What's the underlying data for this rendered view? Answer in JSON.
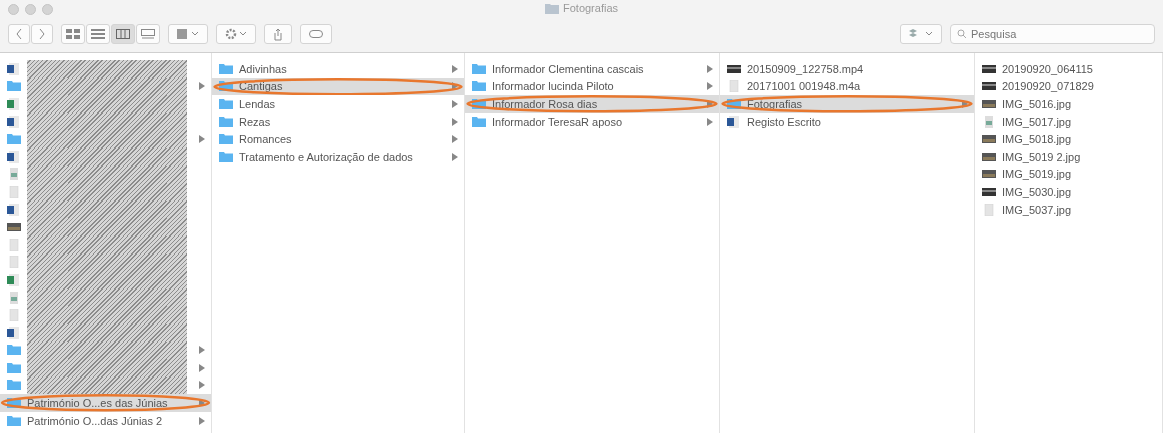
{
  "window": {
    "title": "Fotografias"
  },
  "toolbar": {
    "views": [
      {
        "kind": "icons",
        "selected": false
      },
      {
        "kind": "list",
        "selected": false
      },
      {
        "kind": "columns",
        "selected": true
      },
      {
        "kind": "gallery",
        "selected": false
      }
    ],
    "search": {
      "placeholder": "Pesquisa"
    }
  },
  "columns": [
    {
      "items": [
        {
          "kind": "word",
          "redacted": true,
          "arrow": false,
          "selected": false,
          "circled": false
        },
        {
          "kind": "folder",
          "redacted": true,
          "arrow": true,
          "selected": false,
          "circled": false
        },
        {
          "kind": "excel",
          "redacted": true,
          "arrow": false,
          "selected": false,
          "circled": false
        },
        {
          "kind": "word",
          "redacted": true,
          "arrow": false,
          "selected": false,
          "circled": false
        },
        {
          "kind": "folder",
          "redacted": true,
          "arrow": true,
          "selected": false,
          "circled": false
        },
        {
          "kind": "word",
          "redacted": true,
          "arrow": false,
          "selected": false,
          "circled": false
        },
        {
          "kind": "image",
          "redacted": true,
          "arrow": false,
          "selected": false,
          "circled": false
        },
        {
          "kind": "file",
          "redacted": true,
          "arrow": false,
          "selected": false,
          "circled": false
        },
        {
          "kind": "word",
          "redacted": true,
          "arrow": false,
          "selected": false,
          "circled": false
        },
        {
          "kind": "photo",
          "redacted": true,
          "arrow": false,
          "selected": false,
          "circled": false
        },
        {
          "kind": "file",
          "redacted": true,
          "arrow": false,
          "selected": false,
          "circled": false
        },
        {
          "kind": "file",
          "redacted": true,
          "arrow": false,
          "selected": false,
          "circled": false
        },
        {
          "kind": "excel",
          "redacted": true,
          "arrow": false,
          "selected": false,
          "circled": false
        },
        {
          "kind": "image",
          "redacted": true,
          "arrow": false,
          "selected": false,
          "circled": false
        },
        {
          "kind": "file",
          "redacted": true,
          "arrow": false,
          "selected": false,
          "circled": false
        },
        {
          "kind": "word",
          "redacted": true,
          "arrow": false,
          "selected": false,
          "circled": false
        },
        {
          "kind": "folder",
          "redacted": true,
          "arrow": true,
          "selected": false,
          "circled": false
        },
        {
          "kind": "folder",
          "redacted": true,
          "arrow": true,
          "selected": false,
          "circled": false
        },
        {
          "kind": "folder",
          "redacted": true,
          "arrow": true,
          "selected": false,
          "circled": false
        },
        {
          "name": "Património O...es das Júnias",
          "kind": "folder",
          "redacted": false,
          "arrow": true,
          "selected": true,
          "circled": true
        },
        {
          "name": "Património O...das Júnias 2",
          "kind": "folder",
          "redacted": false,
          "arrow": true,
          "selected": false,
          "circled": false
        }
      ]
    },
    {
      "items": [
        {
          "name": "Adivinhas",
          "kind": "folder",
          "arrow": true,
          "selected": false,
          "circled": false
        },
        {
          "name": "Cantigas",
          "kind": "folder",
          "arrow": true,
          "selected": true,
          "circled": true
        },
        {
          "name": "Lendas",
          "kind": "folder",
          "arrow": true,
          "selected": false,
          "circled": false
        },
        {
          "name": "Rezas",
          "kind": "folder",
          "arrow": true,
          "selected": false,
          "circled": false
        },
        {
          "name": "Romances",
          "kind": "folder",
          "arrow": true,
          "selected": false,
          "circled": false
        },
        {
          "name": "Tratamento e Autorização de dados",
          "kind": "folder",
          "arrow": true,
          "selected": false,
          "circled": false
        }
      ]
    },
    {
      "items": [
        {
          "name": "Informador Clementina cascais",
          "kind": "folder",
          "arrow": true,
          "selected": false,
          "circled": false
        },
        {
          "name": "Informador lucinda Piloto",
          "kind": "folder",
          "arrow": true,
          "selected": false,
          "circled": false
        },
        {
          "name": "Informador Rosa dias",
          "kind": "folder",
          "arrow": true,
          "selected": true,
          "circled": true
        },
        {
          "name": "Informador TeresaR aposo",
          "kind": "folder",
          "arrow": true,
          "selected": false,
          "circled": false
        }
      ]
    },
    {
      "items": [
        {
          "name": "20150909_122758.mp4",
          "kind": "video",
          "arrow": false,
          "selected": false,
          "circled": false
        },
        {
          "name": "20171001 001948.m4a",
          "kind": "file",
          "arrow": false,
          "selected": false,
          "circled": false
        },
        {
          "name": "Fotografias",
          "kind": "folder",
          "arrow": true,
          "selected": true,
          "circled": true
        },
        {
          "name": "Registo Escrito",
          "kind": "word",
          "arrow": false,
          "selected": false,
          "circled": false
        }
      ]
    },
    {
      "items": [
        {
          "name": "20190920_064115",
          "kind": "video",
          "arrow": false,
          "selected": false,
          "circled": false
        },
        {
          "name": "20190920_071829",
          "kind": "video",
          "arrow": false,
          "selected": false,
          "circled": false
        },
        {
          "name": "IMG_5016.jpg",
          "kind": "photo",
          "arrow": false,
          "selected": false,
          "circled": false
        },
        {
          "name": "IMG_5017.jpg",
          "kind": "image",
          "arrow": false,
          "selected": false,
          "circled": false
        },
        {
          "name": "IMG_5018.jpg",
          "kind": "photo",
          "arrow": false,
          "selected": false,
          "circled": false
        },
        {
          "name": "IMG_5019 2.jpg",
          "kind": "photo",
          "arrow": false,
          "selected": false,
          "circled": false
        },
        {
          "name": "IMG_5019.jpg",
          "kind": "photo",
          "arrow": false,
          "selected": false,
          "circled": false
        },
        {
          "name": "IMG_5030.jpg",
          "kind": "video",
          "arrow": false,
          "selected": false,
          "circled": false
        },
        {
          "name": "IMG_5037.jpg",
          "kind": "file",
          "arrow": false,
          "selected": false,
          "circled": false
        }
      ]
    }
  ]
}
